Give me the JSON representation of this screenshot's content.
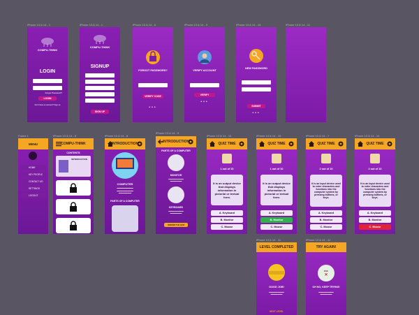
{
  "labels": {
    "f1": "iPhone 13 & 14 - 1",
    "f2": "iPhone 13 & 14 - 1",
    "f3": "iPhone 13 & 14 - 6",
    "f4": "iPhone 13 & 14 - 9",
    "f5": "iPhone 13 & 14 - 10",
    "f6": "iPhone 13 & 14 - 11",
    "f7": "Frame 1",
    "f8": "iPhone 13 & 14 - 8",
    "f9": "iPhone 13 & 14 - 8",
    "f10": "iPhone 13 & 14 - 9",
    "f11": "iPhone 13 & 14 - 13",
    "f12": "iPhone 13 & 14 - 15",
    "f13": "iPhone 13 & 14 - 7",
    "f14": "iPhone 13 & 14 - 14",
    "f15": "iPhone 13 & 14 - 11",
    "f16": "iPhone 13 & 14 - 12"
  },
  "brand": "COMPU-THINK",
  "login": {
    "title": "LOGIN",
    "forgot": "Forgot Password?",
    "button": "LOGIN",
    "footer": "Don't have an account? Sign up"
  },
  "signup": {
    "title": "SIGNUP",
    "button": "SIGN UP"
  },
  "forgot": {
    "title": "FORGOT PASSWORD?",
    "button": "VERIFY CODE"
  },
  "verify": {
    "title": "VERIFY ACCOUNT",
    "button": "VERIFY"
  },
  "newpass": {
    "title": "NEW PASSWORD",
    "button": "SUBMIT"
  },
  "menu": {
    "title": "MENU",
    "items": [
      "HOME",
      "KEY PEOPLE",
      "CONTACT US",
      "SETTINGS",
      "LOGOUT"
    ]
  },
  "contents": {
    "header": "COMPU-THINK",
    "sub": "CONTENTS",
    "intro": "INTRODUCTION"
  },
  "intro": {
    "header": "INTRODUCTION",
    "computer": "COMPUTER",
    "parts": "PARTS OF A COMPUTER"
  },
  "intro2": {
    "header": "INTRODUCTION",
    "parts": "PARTS OF A COMPUTER",
    "monitor": "MONITOR",
    "keyboard": "KEYBOARD",
    "button": "ANSWER THE QUIZ"
  },
  "quiz": {
    "header": "QUIZ TIME",
    "q1": "1 out of 10",
    "q2": "2 out of 10",
    "question1": "It is an output device that displays information in pictorial or textual form.",
    "question2": "It is an input device used to enter characters and functions into the computer system by pressing buttons, or keys.",
    "options": [
      "A.  Keyboard",
      "B.  Monitor",
      "C.  Mouse"
    ]
  },
  "result": {
    "complete": "LEVEL COMPLETED",
    "good": "GOOD JOB!",
    "next": "NEXT LEVEL",
    "again": "TRY AGAIN!",
    "ohno": "OH NO, KEEP TRYING!",
    "fail": "FAIL"
  },
  "colors": {
    "bg": "#595562",
    "purple": "#8a1fb3",
    "orange": "#f5a623",
    "pink": "#c0168e",
    "green": "#2fb24a",
    "red": "#e0223a"
  }
}
